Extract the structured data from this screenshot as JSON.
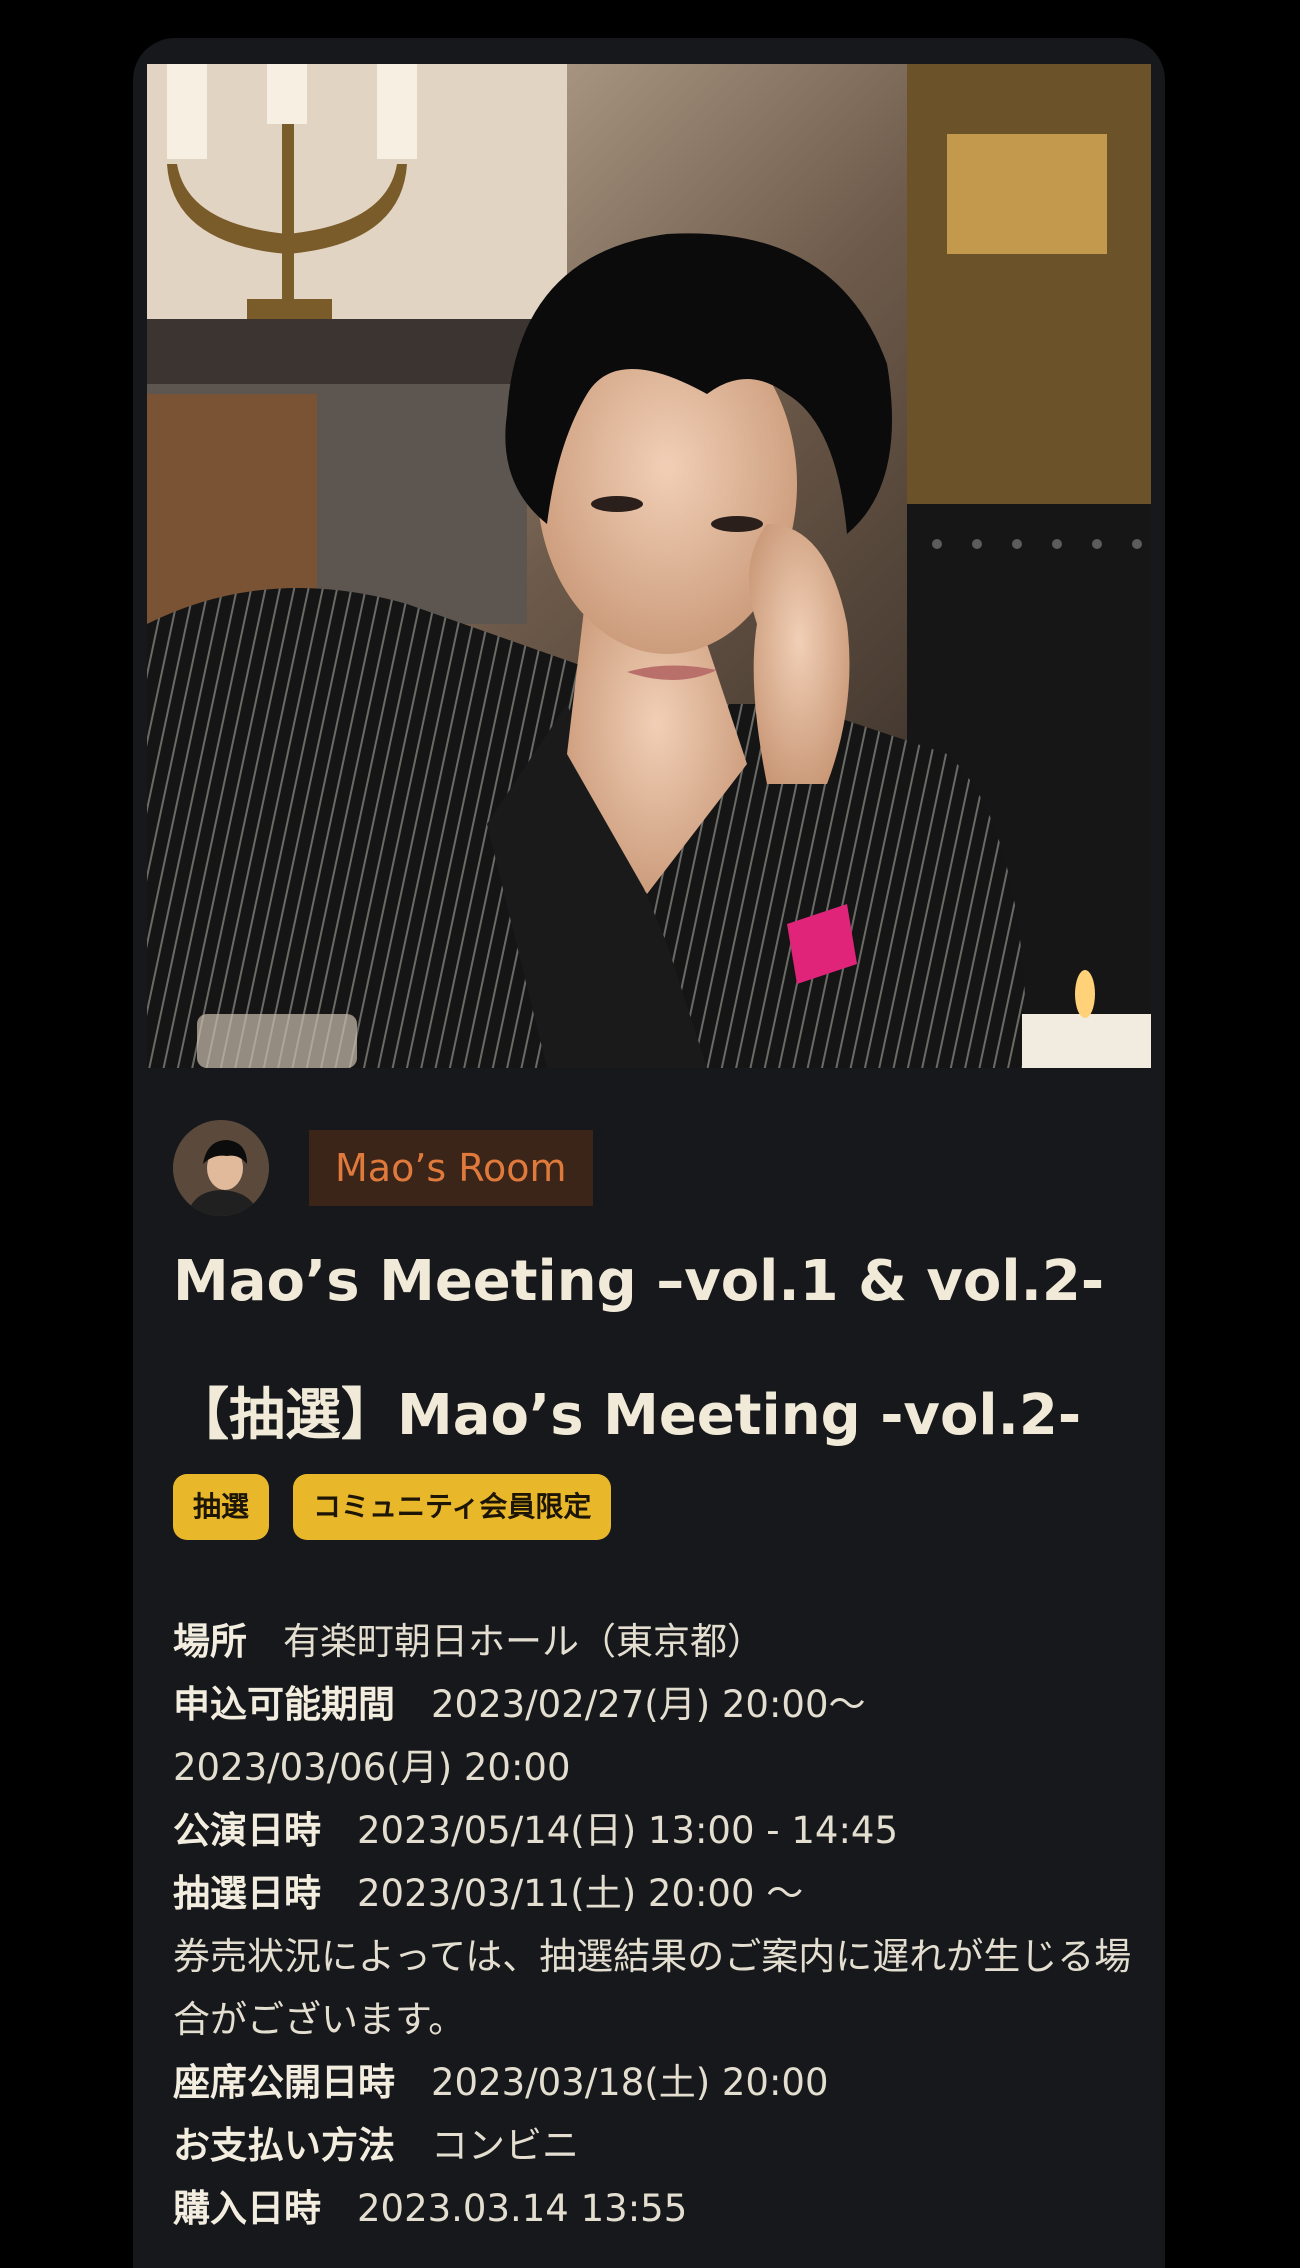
{
  "channel": {
    "name": "Mao’s Room",
    "avatar_icon": "artist-avatar"
  },
  "event": {
    "title": "Mao’s Meeting –vol.1 & vol.2-",
    "subtitle": "【抽選】Mao’s Meeting -vol.2-",
    "tags": [
      "抽選",
      "コミュニティ会員限定"
    ]
  },
  "details": {
    "venue_label": "場所",
    "venue_value": "有楽町朝日ホール（東京都）",
    "application_label": "申込可能期間",
    "application_value_line1": "2023/02/27(月) 20:00〜",
    "application_value_line2": "2023/03/06(月) 20:00",
    "performance_label": "公演日時",
    "performance_value": "2023/05/14(日) 13:00 - 14:45",
    "lottery_label": "抽選日時",
    "lottery_value": "2023/03/11(土) 20:00 〜",
    "lottery_note": "券売状況によっては、抽選結果のご案内に遅れが生じる場合がございます。",
    "seat_label": "座席公開日時",
    "seat_value": "2023/03/18(土) 20:00",
    "payment_label": "お支払い方法",
    "payment_value": "コンビニ",
    "purchase_label": "購入日時",
    "purchase_value": "2023.03.14 13:55"
  },
  "colors": {
    "background": "#000000",
    "card": "#16181b",
    "channel_badge_bg": "#3b2418",
    "channel_badge_text": "#e07a3c",
    "tag_bg": "#e9b82a"
  }
}
